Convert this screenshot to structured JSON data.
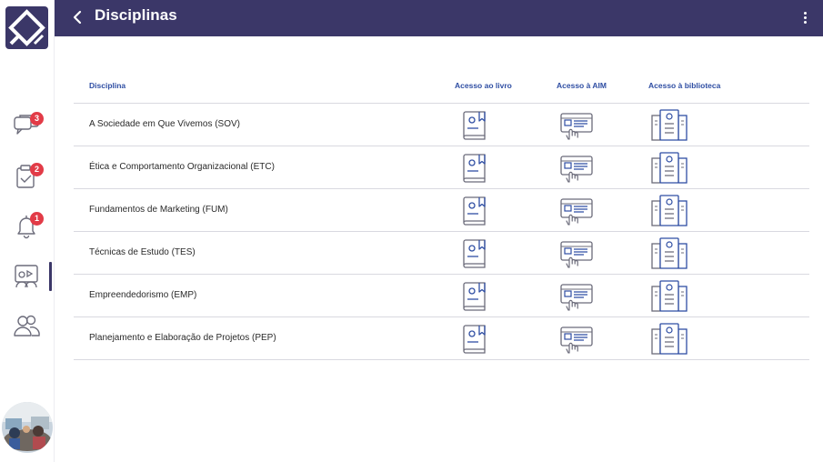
{
  "header": {
    "title": "Disciplinas"
  },
  "sidebar": {
    "items": [
      {
        "name": "messages",
        "badge": "3"
      },
      {
        "name": "tasks",
        "badge": "2"
      },
      {
        "name": "notifications",
        "badge": "1"
      },
      {
        "name": "classes",
        "badge": ""
      },
      {
        "name": "community",
        "badge": ""
      }
    ]
  },
  "table": {
    "headers": {
      "discipline": "Disciplina",
      "book": "Acesso ao livro",
      "aim": "Acesso à AIM",
      "library": "Acesso à biblioteca"
    },
    "rows": [
      {
        "name": "A Sociedade em Que Vivemos (SOV)"
      },
      {
        "name": "Ética e Comportamento Organizacional (ETC)"
      },
      {
        "name": "Fundamentos de Marketing (FUM)"
      },
      {
        "name": "Técnicas de Estudo (TES)"
      },
      {
        "name": "Empreendedorismo (EMP)"
      },
      {
        "name": "Planejamento e Elaboração de Projetos (PEP)"
      }
    ]
  },
  "colors": {
    "header_bg": "#3b3768",
    "accent": "#2f4ea3",
    "badge": "#e23b47",
    "icon_gray": "#6b6b7a"
  }
}
